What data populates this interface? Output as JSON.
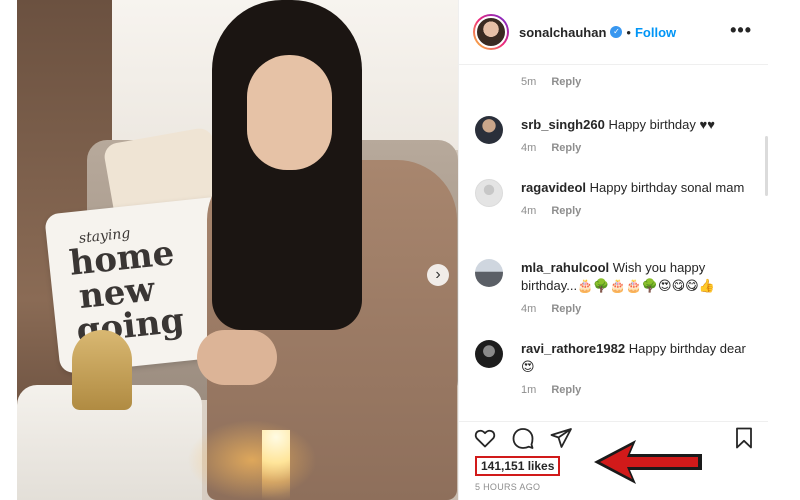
{
  "post": {
    "username": "sonalchauhan",
    "follow_label": "Follow",
    "dot": "•",
    "verified_mark": "✓",
    "more_label": "•••",
    "pillow_text": [
      "staying",
      "home",
      "new",
      "going"
    ]
  },
  "comments": [
    {
      "user": "",
      "text": "",
      "time": "5m",
      "reply": "Reply"
    },
    {
      "user": "srb_singh260",
      "text": "Happy birthday ♥♥",
      "time": "4m",
      "reply": "Reply"
    },
    {
      "user": "ragavideol",
      "text": "Happy birthday sonal mam",
      "time": "4m",
      "reply": "Reply"
    },
    {
      "user": "mla_rahulcool",
      "text": "Wish you happy birthday...🎂🌳🎂🎂🌳😍😋😋👍",
      "time": "4m",
      "reply": "Reply"
    },
    {
      "user": "ravi_rathore1982",
      "text": "Happy birthday dear 😍",
      "time": "1m",
      "reply": "Reply"
    }
  ],
  "footer": {
    "likes": "141,151 likes",
    "time": "5 HOURS AGO"
  },
  "colors": {
    "follow": "#0095f6",
    "highlight": "#d11a1a"
  }
}
